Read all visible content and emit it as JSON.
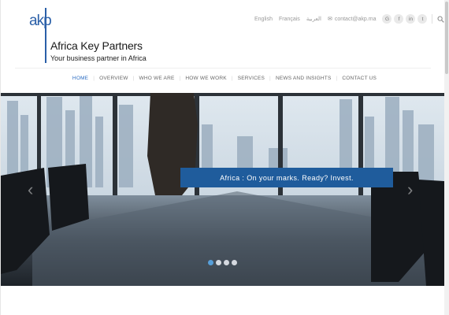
{
  "brand": {
    "logo_mark": "akp",
    "name": "Africa Key Partners",
    "tagline": "Your business partner in Africa"
  },
  "topbar": {
    "languages": [
      "English",
      "Français",
      "العربية"
    ],
    "email": "contact@akp.ma",
    "social_icons": [
      "google-plus-icon",
      "facebook-icon",
      "linkedin-icon",
      "twitter-icon"
    ],
    "social_glyphs": [
      "G",
      "f",
      "in",
      "t"
    ]
  },
  "nav": {
    "items": [
      {
        "label": "HOME",
        "active": true
      },
      {
        "label": "OVERVIEW",
        "active": false
      },
      {
        "label": "WHO WE ARE",
        "active": false
      },
      {
        "label": "HOW WE WORK",
        "active": false
      },
      {
        "label": "SERVICES",
        "active": false
      },
      {
        "label": "NEWS AND INSIGHTS",
        "active": false
      },
      {
        "label": "CONTACT US",
        "active": false
      }
    ]
  },
  "hero": {
    "caption": "Africa : On your marks. Ready? Invest.",
    "slide_count": 4,
    "active_slide": 1,
    "prev_glyph": "‹",
    "next_glyph": "›"
  },
  "colors": {
    "accent": "#2a6cc2",
    "caption_band": "#1f5c9c",
    "logo": "#2a5fa8"
  }
}
